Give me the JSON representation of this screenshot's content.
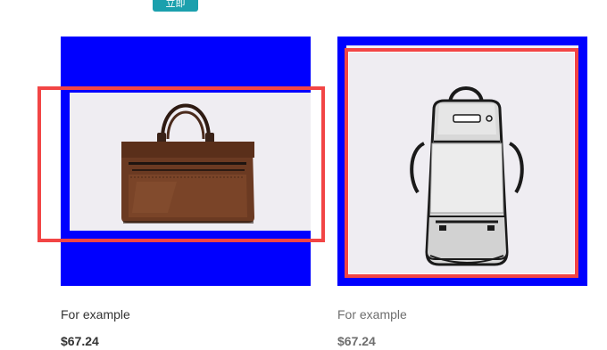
{
  "top_button": {
    "label": "立即"
  },
  "products": [
    {
      "name": "For example",
      "price": "$67.24",
      "image_icon": "leather-briefcase-icon"
    },
    {
      "name": "For example",
      "price": "$67.24",
      "image_icon": "backpack-icon"
    }
  ],
  "colors": {
    "placeholder_bg": "#0000ff",
    "photo_bg": "#efedf2",
    "highlight": "#f24545",
    "accent_button": "#1ba0ad"
  }
}
